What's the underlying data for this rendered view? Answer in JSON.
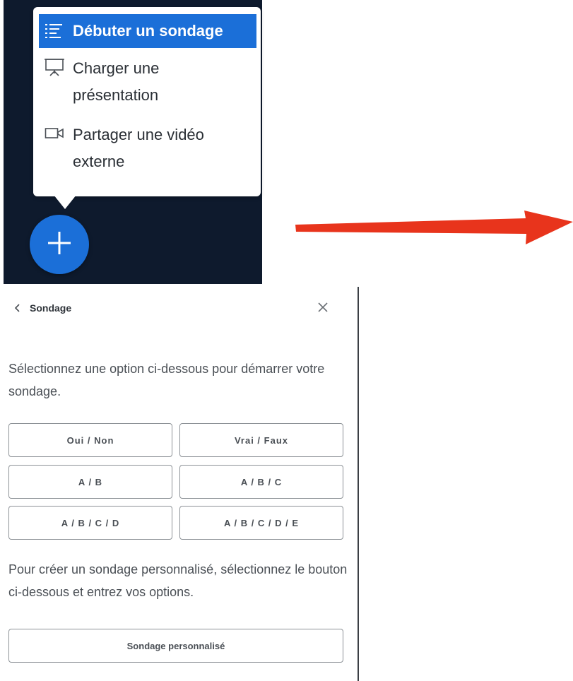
{
  "action_menu": {
    "items": [
      {
        "label": "Débuter un sondage",
        "icon": "poll-icon",
        "active": true
      },
      {
        "label": "Charger une présentation",
        "icon": "presentation-icon",
        "active": false
      },
      {
        "label": "Partager une vidéo externe",
        "icon": "video-icon",
        "active": false
      }
    ],
    "fab_icon": "plus-icon"
  },
  "poll_panel": {
    "title": "Sondage",
    "back_icon": "chevron-left-icon",
    "close_icon": "close-icon",
    "intro": "Sélectionnez une option ci-dessous pour démarrer votre sondage.",
    "options": [
      "Oui / Non",
      "Vrai / Faux",
      "A / B",
      "A / B / C",
      "A / B / C / D",
      "A / B / C / D / E"
    ],
    "custom_intro": "Pour créer un sondage personnalisé, sélectionnez le bouton ci-dessous et entrez vos options.",
    "custom_button": "Sondage personnalisé"
  },
  "colors": {
    "dark_background": "#0e1a2d",
    "accent_blue": "#1b6fd8",
    "arrow_red": "#e8341c"
  }
}
